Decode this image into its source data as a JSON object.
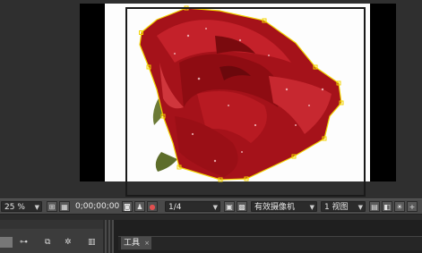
{
  "viewer": {
    "zoom": "25 %",
    "timecode": "0;00;00;00",
    "resolution": "1/4",
    "camera": "有效摄像机",
    "views": "1 视图"
  },
  "toolbar_icons": [
    "region-icon",
    "transparency-grid-icon",
    "snapshot-icon",
    "show-snapshot-icon",
    "channel-icon",
    "fast-preview-icon",
    "toggle-view-icon",
    "layout-icon",
    "reset-exposure-icon",
    "exposure-icon"
  ],
  "panel": {
    "tab_label": "工具",
    "tab_close": "×"
  },
  "colors": {
    "mask_path": "#f2d400",
    "rose_dark": "#7a0a0e",
    "rose_mid": "#b3151b",
    "rose_light": "#d42a2e"
  }
}
